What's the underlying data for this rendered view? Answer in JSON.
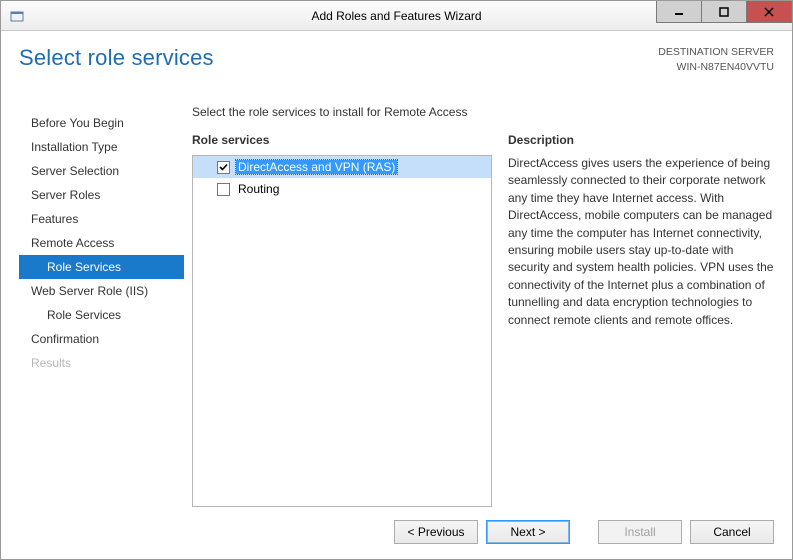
{
  "window": {
    "title": "Add Roles and Features Wizard"
  },
  "header": {
    "page_title": "Select role services",
    "dest_label": "DESTINATION SERVER",
    "dest_value": "WIN-N87EN40VVTU"
  },
  "sidebar": {
    "items": [
      {
        "label": "Before You Begin",
        "selected": false,
        "indent": false,
        "disabled": false
      },
      {
        "label": "Installation Type",
        "selected": false,
        "indent": false,
        "disabled": false
      },
      {
        "label": "Server Selection",
        "selected": false,
        "indent": false,
        "disabled": false
      },
      {
        "label": "Server Roles",
        "selected": false,
        "indent": false,
        "disabled": false
      },
      {
        "label": "Features",
        "selected": false,
        "indent": false,
        "disabled": false
      },
      {
        "label": "Remote Access",
        "selected": false,
        "indent": false,
        "disabled": false
      },
      {
        "label": "Role Services",
        "selected": true,
        "indent": true,
        "disabled": false
      },
      {
        "label": "Web Server Role (IIS)",
        "selected": false,
        "indent": false,
        "disabled": false
      },
      {
        "label": "Role Services",
        "selected": false,
        "indent": true,
        "disabled": false
      },
      {
        "label": "Confirmation",
        "selected": false,
        "indent": false,
        "disabled": false
      },
      {
        "label": "Results",
        "selected": false,
        "indent": false,
        "disabled": true
      }
    ]
  },
  "main": {
    "instruction": "Select the role services to install for Remote Access",
    "services_label": "Role services",
    "services": [
      {
        "label": "DirectAccess and VPN (RAS)",
        "checked": true,
        "selected": true
      },
      {
        "label": "Routing",
        "checked": false,
        "selected": false
      }
    ],
    "description_label": "Description",
    "description_text": "DirectAccess gives users the experience of being seamlessly connected to their corporate network any time they have Internet access. With DirectAccess, mobile computers can be managed any time the computer has Internet connectivity, ensuring mobile users stay up-to-date with security and system health policies. VPN uses the connectivity of the Internet plus a combination of tunnelling and data encryption technologies to connect remote clients and remote offices."
  },
  "footer": {
    "previous": "< Previous",
    "next": "Next >",
    "install": "Install",
    "cancel": "Cancel"
  }
}
